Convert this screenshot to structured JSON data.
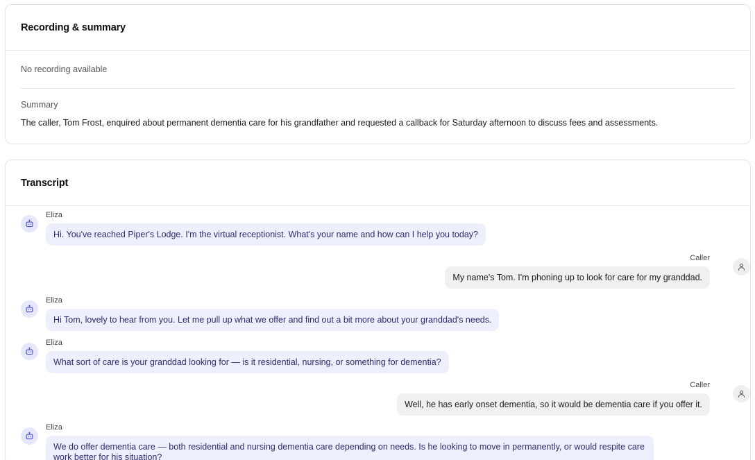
{
  "recording_card": {
    "title": "Recording & summary",
    "no_recording": "No recording available",
    "summary_label": "Summary",
    "summary_text": "The caller, Tom Frost, enquired about permanent dementia care for his grandfather and requested a callback for Saturday afternoon to discuss fees and assessments."
  },
  "transcript_card": {
    "title": "Transcript",
    "messages": [
      {
        "role": "agent",
        "speaker": "Eliza",
        "text": "Hi. You've reached Piper's Lodge. I'm the virtual receptionist. What's your name and how can I help you today?"
      },
      {
        "role": "caller",
        "speaker": "Caller",
        "text": "My name's Tom. I'm phoning up to look for care for my granddad."
      },
      {
        "role": "agent",
        "speaker": "Eliza",
        "text": "Hi Tom, lovely to hear from you. Let me pull up what we offer and find out a bit more about your granddad's needs."
      },
      {
        "role": "agent",
        "speaker": "Eliza",
        "text": "What sort of care is your granddad looking for — is it residential, nursing, or something for dementia?"
      },
      {
        "role": "caller",
        "speaker": "Caller",
        "text": "Well, he has early onset dementia, so it would be dementia care if you offer it."
      },
      {
        "role": "agent",
        "speaker": "Eliza",
        "text": "We do offer dementia care — both residential and nursing dementia care depending on needs. Is he looking to move in permanently, or would respite care work better for his situation?"
      }
    ]
  },
  "icons": {
    "agent": "robot-icon",
    "caller": "user-icon"
  }
}
